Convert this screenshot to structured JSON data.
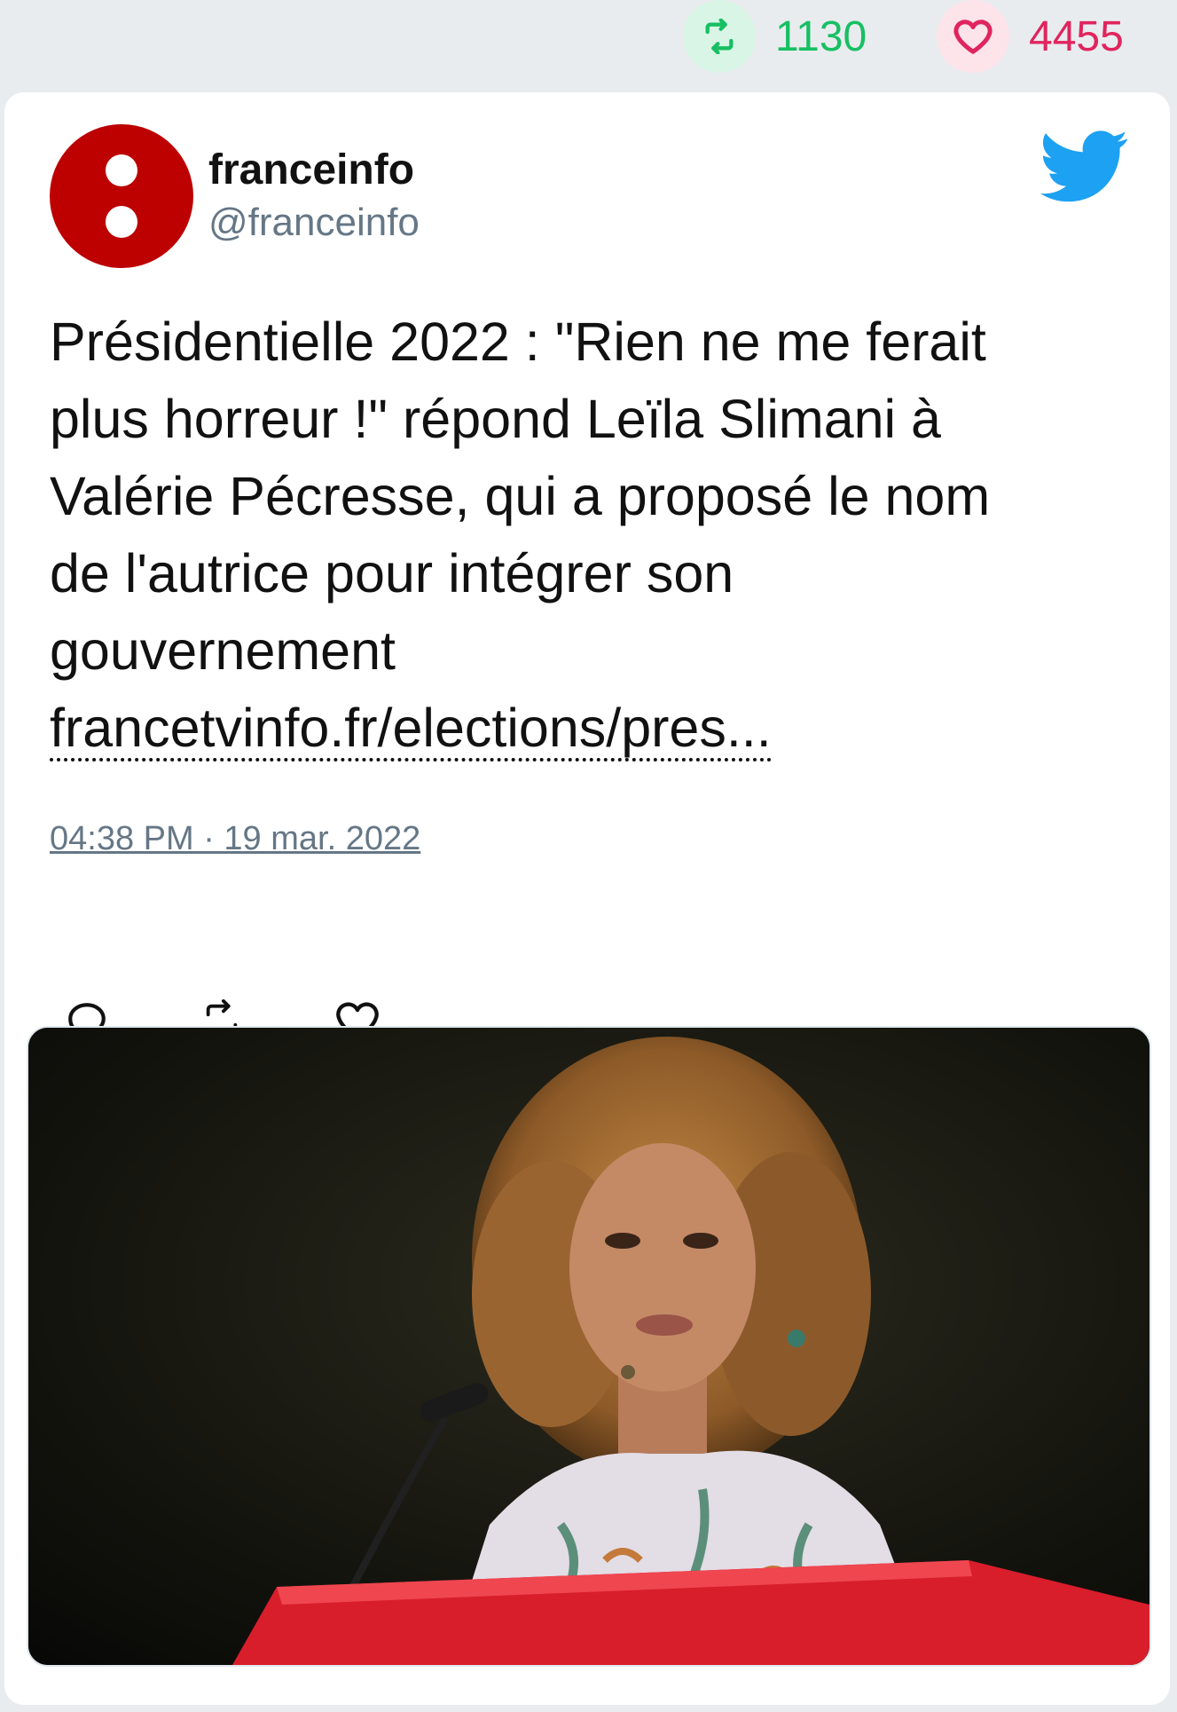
{
  "stats": {
    "retweets": "1130",
    "likes": "4455",
    "retweet_color": "#17bf63",
    "like_color": "#e0245e"
  },
  "tweet": {
    "author_name": "franceinfo",
    "author_handle": "@franceinfo",
    "avatar_color": "#bd0000",
    "text_lines": [
      "Présidentielle 2022 : \"Rien ne me ferait",
      "plus horreur !\" répond Leïla Slimani à",
      "Valérie Pécresse, qui a proposé le nom",
      "de l'autrice pour intégrer son",
      "gouvernement"
    ],
    "link_text": "francetvinfo.fr/elections/pres...",
    "timestamp": "04:38 PM · 19 mar. 2022",
    "icons": [
      "reply-icon",
      "retweet-icon",
      "like-icon",
      "twitter-bird-icon"
    ]
  }
}
